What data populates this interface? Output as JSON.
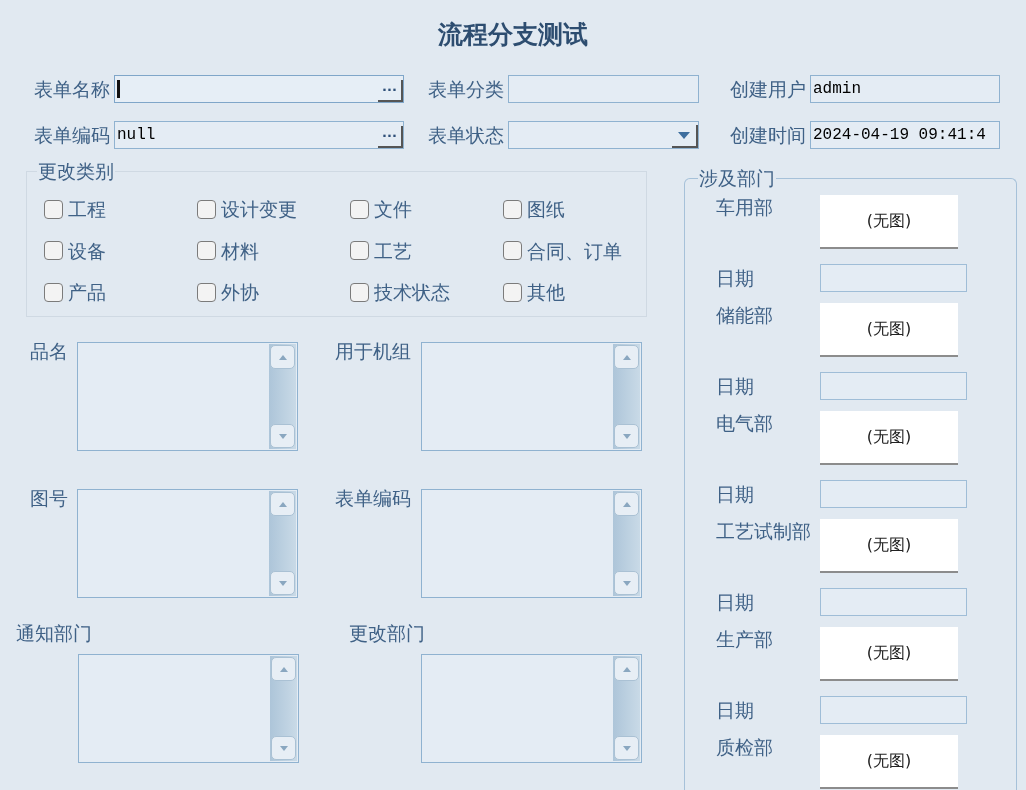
{
  "title": "流程分支测试",
  "header_fields": [
    {
      "label": "表单名称",
      "kind": "browse",
      "button": "...",
      "focused": true
    },
    {
      "label": "表单分类",
      "kind": "text"
    },
    {
      "label": "创建用户",
      "kind": "text",
      "value": "admin"
    },
    {
      "label": "表单编码",
      "kind": "browse",
      "value": "null",
      "button": "...",
      "focused": false
    },
    {
      "label": "表单状态",
      "kind": "dropdown"
    },
    {
      "label": "创建时间",
      "kind": "text",
      "value": "2024-04-19 09:41:4"
    }
  ],
  "change_category": {
    "title": "更改类别",
    "options": [
      {
        "label": "工程",
        "checked": false
      },
      {
        "label": "设计变更",
        "checked": false
      },
      {
        "label": "文件",
        "checked": false
      },
      {
        "label": "图纸",
        "checked": false
      },
      {
        "label": "设备",
        "checked": false
      },
      {
        "label": "材料",
        "checked": false
      },
      {
        "label": "工艺",
        "checked": false
      },
      {
        "label": "合同、订单",
        "checked": false
      },
      {
        "label": "产品",
        "checked": false
      },
      {
        "label": "外协",
        "checked": false
      },
      {
        "label": "技术状态",
        "checked": false
      },
      {
        "label": "其他",
        "checked": false
      }
    ]
  },
  "list_fields": [
    {
      "label": "品名"
    },
    {
      "label": "用于机组"
    },
    {
      "label": "图号"
    },
    {
      "label": "表单编码"
    }
  ],
  "lower_list_fields": [
    {
      "label": "通知部门"
    },
    {
      "label": "更改部门"
    }
  ],
  "departments": {
    "title": "涉及部门",
    "items": [
      {
        "name": "车用部",
        "image": "(无图)",
        "date_label": "日期"
      },
      {
        "name": "储能部",
        "image": "(无图)",
        "date_label": "日期"
      },
      {
        "name": "电气部",
        "image": "(无图)",
        "date_label": "日期"
      },
      {
        "name": "工艺试制部",
        "image": "(无图)",
        "date_label": "日期"
      },
      {
        "name": "生产部",
        "image": "(无图)",
        "date_label": "日期"
      },
      {
        "name": "质检部",
        "image": "(无图)"
      }
    ]
  }
}
